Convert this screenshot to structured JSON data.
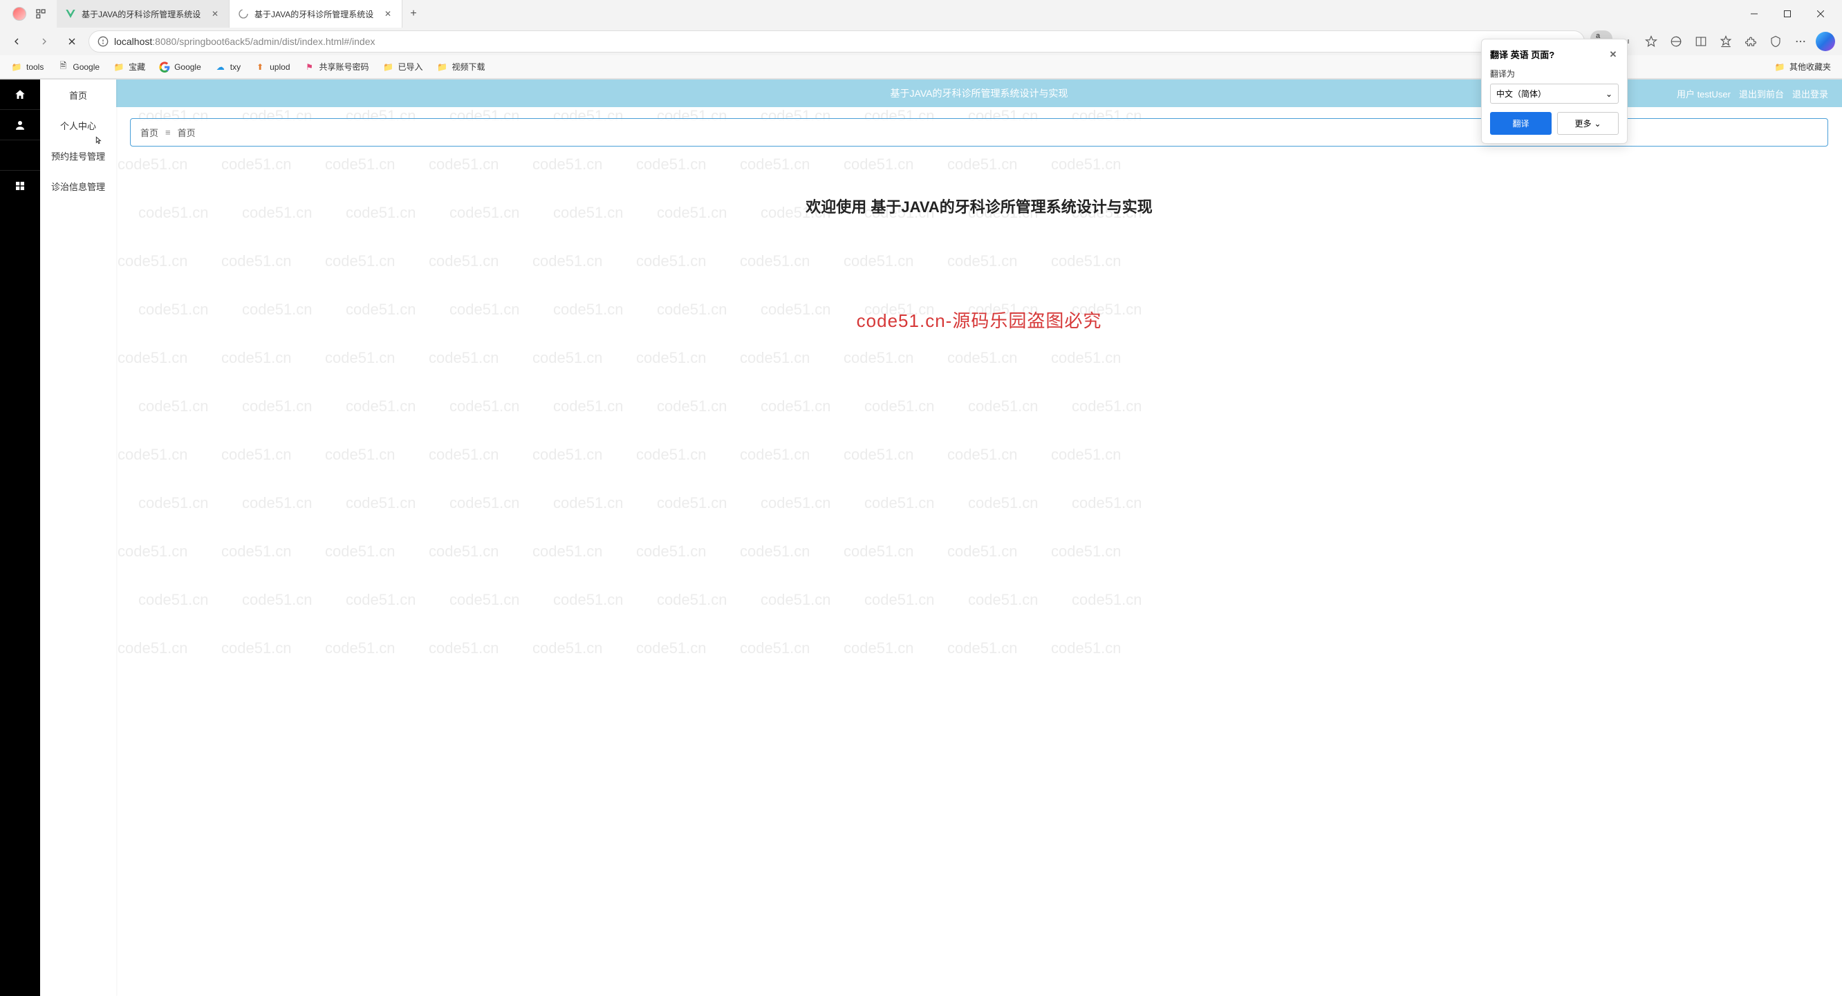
{
  "browser": {
    "tabs": [
      {
        "title": "基于JAVA的牙科诊所管理系统设",
        "active": false
      },
      {
        "title": "基于JAVA的牙科诊所管理系统设",
        "active": true
      }
    ],
    "url_host": "localhost",
    "url_port": ":8080",
    "url_path": "/springboot6ack5/admin/dist/index.html#/index",
    "translate_badge": "a由",
    "bookmarks": [
      {
        "label": "tools",
        "type": "folder"
      },
      {
        "label": "Google",
        "type": "page"
      },
      {
        "label": "宝藏",
        "type": "folder"
      },
      {
        "label": "Google",
        "type": "google"
      },
      {
        "label": "txy",
        "type": "cloud"
      },
      {
        "label": "uplod",
        "type": "upload"
      },
      {
        "label": "共享账号密码",
        "type": "share"
      },
      {
        "label": "已导入",
        "type": "folder"
      },
      {
        "label": "视频下载",
        "type": "folder"
      }
    ],
    "other_bookmarks": "其他收藏夹"
  },
  "translate_popup": {
    "title": "翻译 英语 页面?",
    "label": "翻译为",
    "selected": "中文（简体）",
    "translate_btn": "翻译",
    "more_btn": "更多"
  },
  "sidebar": {
    "items": [
      {
        "label": "首页",
        "icon": "home"
      },
      {
        "label": "个人中心",
        "icon": "user"
      },
      {
        "label": "预约挂号管理",
        "icon": ""
      },
      {
        "label": "诊治信息管理",
        "icon": "grid"
      }
    ]
  },
  "banner": {
    "title": "基于JAVA的牙科诊所管理系统设计与实现",
    "user_label": "用户 testUser",
    "exit_front": "退出到前台",
    "logout": "退出登录"
  },
  "breadcrumb": {
    "first": "首页",
    "second": "首页"
  },
  "content": {
    "welcome": "欢迎使用 基于JAVA的牙科诊所管理系统设计与实现",
    "watermark_center": "code51.cn-源码乐园盗图必究",
    "watermark_text": "code51.cn"
  }
}
